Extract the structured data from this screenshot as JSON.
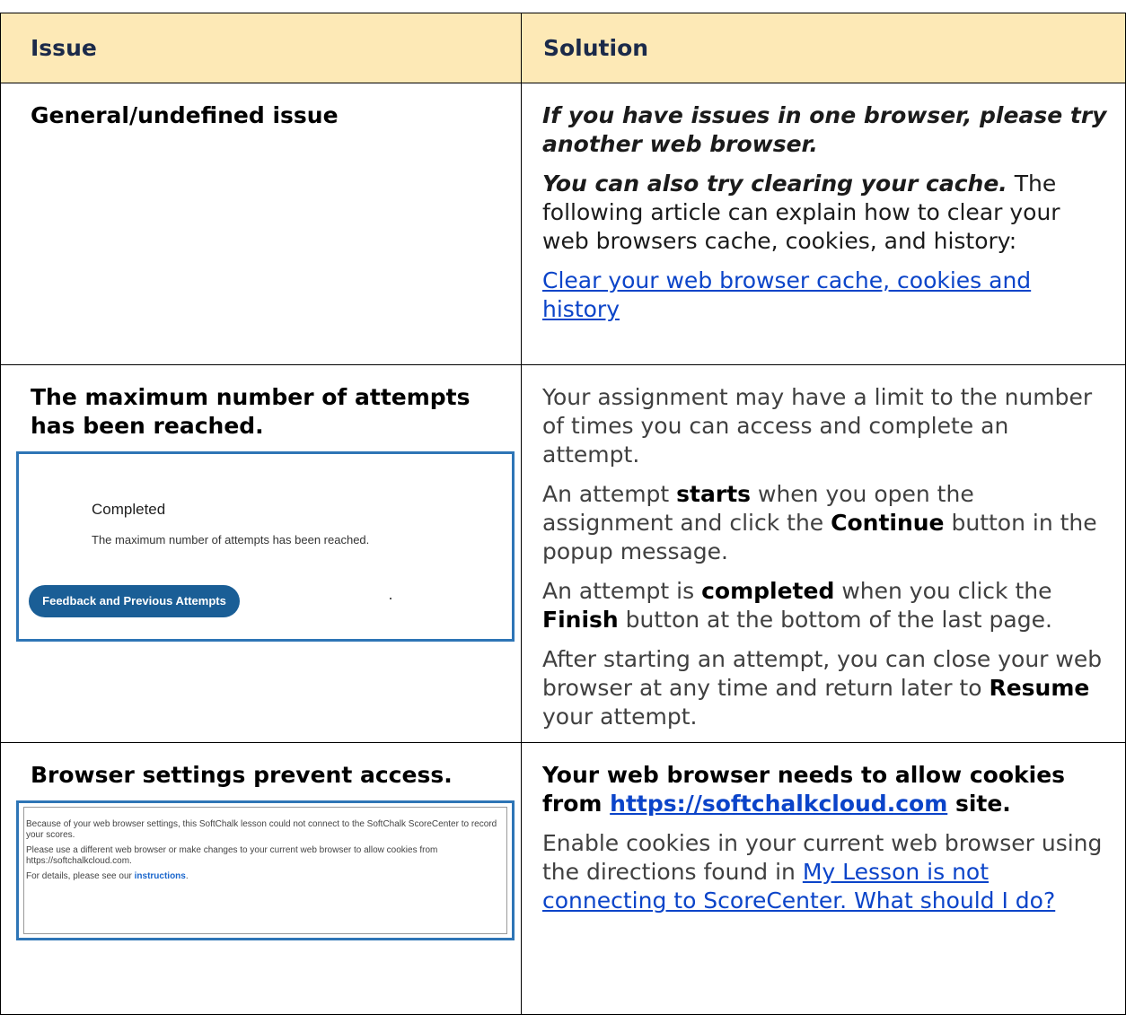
{
  "table": {
    "headers": {
      "issue": "Issue",
      "solution": "Solution"
    },
    "rows": [
      {
        "issue": "General/undefined issue",
        "solution": {
          "p1": "If you have issues in one browser, please try another web browser.",
          "p2_bold": "You can also try clearing your cache.",
          "p2_rest": " The following article can explain how to clear your web browsers cache, cookies, and history:",
          "link": "Clear your web browser cache, cookies and history"
        }
      },
      {
        "issue": "The maximum number of attempts has been reached.",
        "screenshot": {
          "title": "Completed",
          "message": "The maximum number of attempts has been reached.",
          "button": "Feedback and Previous Attempts"
        },
        "solution": {
          "p1": "Your assignment may have a limit to the number of times you can access and complete an attempt.",
          "p2_a": "An attempt ",
          "p2_b": "starts",
          "p2_c": " when you open the assignment and click the ",
          "p2_d": "Continue",
          "p2_e": " button in the popup message.",
          "p3_a": "An attempt is ",
          "p3_b": "completed",
          "p3_c": " when you click the ",
          "p3_d": "Finish",
          "p3_e": " button at the bottom of the last page.",
          "p4_a": "After starting an attempt, you can close your web browser at any time and return later to ",
          "p4_b": "Resume",
          "p4_c": " your attempt."
        }
      },
      {
        "issue": "Browser settings prevent access.",
        "screenshot": {
          "line1": "Because of your web browser settings, this SoftChalk lesson could not connect to the SoftChalk ScoreCenter to record your scores.",
          "line2": "Please use a different web browser or make changes to your current web browser to allow cookies from https://softchalkcloud.com.",
          "line3_prefix": "For details, please see our ",
          "line3_link": "instructions",
          "line3_suffix": "."
        },
        "solution": {
          "heading_a": "Your web browser needs to allow cookies from ",
          "heading_link": "https://softchalkcloud.com",
          "heading_b": " site.",
          "p1_a": "Enable cookies in your current web browser using the directions found in ",
          "p1_link": "My Lesson is not connecting to ScoreCenter. What should I do?"
        }
      }
    ]
  }
}
